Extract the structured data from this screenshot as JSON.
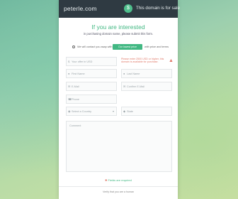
{
  "topbar": {
    "domain": "peterle.com",
    "sale_text": "This domain is for sale",
    "badge_icon": "$"
  },
  "heading": {
    "title": "If you are interested",
    "subtitle": "in purchasing domain name, please submit this form."
  },
  "offer_row": {
    "option1": "We will contact you asap with",
    "offer_button": "Our lowest price",
    "option2": "with price and terms"
  },
  "form": {
    "price_placeholder": "Your offer in USD",
    "first_name_placeholder": "First Name",
    "last_name_placeholder": "Last Name",
    "email_placeholder": "E-Mail",
    "confirm_email_placeholder": "Confirm E-Mail",
    "phone_placeholder": "Phone",
    "country_placeholder": "Select a Country",
    "state_placeholder": "State",
    "comment_placeholder": "Comment",
    "notice": "Please enter 2500 USD or higher, this domain is available for purchase."
  },
  "footer": {
    "required": "Fields are required",
    "verify": "Verify that you are a human"
  },
  "colors": {
    "accent": "#42b883",
    "topbar": "#2f3a42",
    "warning": "#e07a6a"
  }
}
